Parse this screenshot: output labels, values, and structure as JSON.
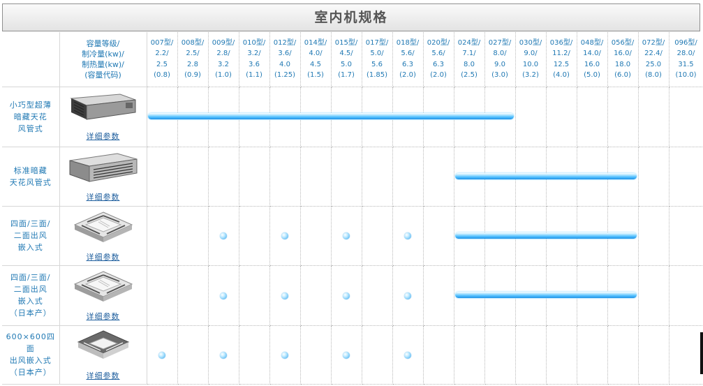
{
  "page": {
    "title": "室内机规格"
  },
  "header": {
    "spec_label": [
      "容量等级/",
      "制冷量(kw)/",
      "制热量(kw)/",
      "(容量代码)"
    ],
    "models": [
      [
        "007型/",
        "2.2/",
        "2.5",
        "(0.8)"
      ],
      [
        "008型/",
        "2.5/",
        "2.8",
        "(0.9)"
      ],
      [
        "009型/",
        "2.8/",
        "3.2",
        "(1.0)"
      ],
      [
        "010型/",
        "3.2/",
        "3.6",
        "(1.1)"
      ],
      [
        "012型/",
        "3.6/",
        "4.0",
        "(1.25)"
      ],
      [
        "014型/",
        "4.0/",
        "4.5",
        "(1.5)"
      ],
      [
        "015型/",
        "4.5/",
        "5.0",
        "(1.7)"
      ],
      [
        "017型/",
        "5.0/",
        "5.6",
        "(1.85)"
      ],
      [
        "018型/",
        "5.6/",
        "6.3",
        "(2.0)"
      ],
      [
        "020型/",
        "5.6/",
        "6.3",
        "(2.0)"
      ],
      [
        "024型/",
        "7.1/",
        "8.0",
        "(2.5)"
      ],
      [
        "027型/",
        "8.0/",
        "9.0",
        "(3.0)"
      ],
      [
        "030型/",
        "9.0/",
        "10.0",
        "(3.2)"
      ],
      [
        "036型/",
        "11.2/",
        "12.5",
        "(4.0)"
      ],
      [
        "048型/",
        "14.0/",
        "16.0",
        "(5.0)"
      ],
      [
        "056型/",
        "16.0/",
        "18.0",
        "(6.0)"
      ],
      [
        "072型/",
        "22.4/",
        "25.0",
        "(8.0)"
      ],
      [
        "096型/",
        "28.0/",
        "31.5",
        "(10.0)"
      ]
    ]
  },
  "detail_link_label": "详细参数",
  "colors": {
    "title_text": "#555555",
    "label_blue": "#1f78b3",
    "bar_blue": "#58c3ff"
  },
  "rows": [
    {
      "name": [
        "小巧型超薄",
        "暗藏天花",
        "风管式"
      ],
      "icon": "ducted-slim-unit-icon",
      "range": [
        0,
        11
      ],
      "dots": []
    },
    {
      "name": [
        "标准暗藏",
        "天花风管式"
      ],
      "icon": "ducted-standard-unit-icon",
      "range": [
        10,
        15
      ],
      "dots": []
    },
    {
      "name": [
        "四面/三面/",
        "二面出风",
        "嵌入式"
      ],
      "icon": "cassette-unit-icon",
      "range": [
        10,
        15
      ],
      "dots": [
        2,
        4,
        6,
        8
      ]
    },
    {
      "name": [
        "四面/三面/",
        "二面出风",
        "嵌入式",
        "（日本产）"
      ],
      "icon": "cassette-unit-icon",
      "range": [
        10,
        15
      ],
      "dots": [
        2,
        4,
        6,
        8
      ]
    },
    {
      "name": [
        "600×600四面",
        "出风嵌入式",
        "（日本产）"
      ],
      "icon": "compact-cassette-unit-icon",
      "range": null,
      "dots": [
        0,
        2,
        4,
        6,
        8
      ]
    }
  ]
}
